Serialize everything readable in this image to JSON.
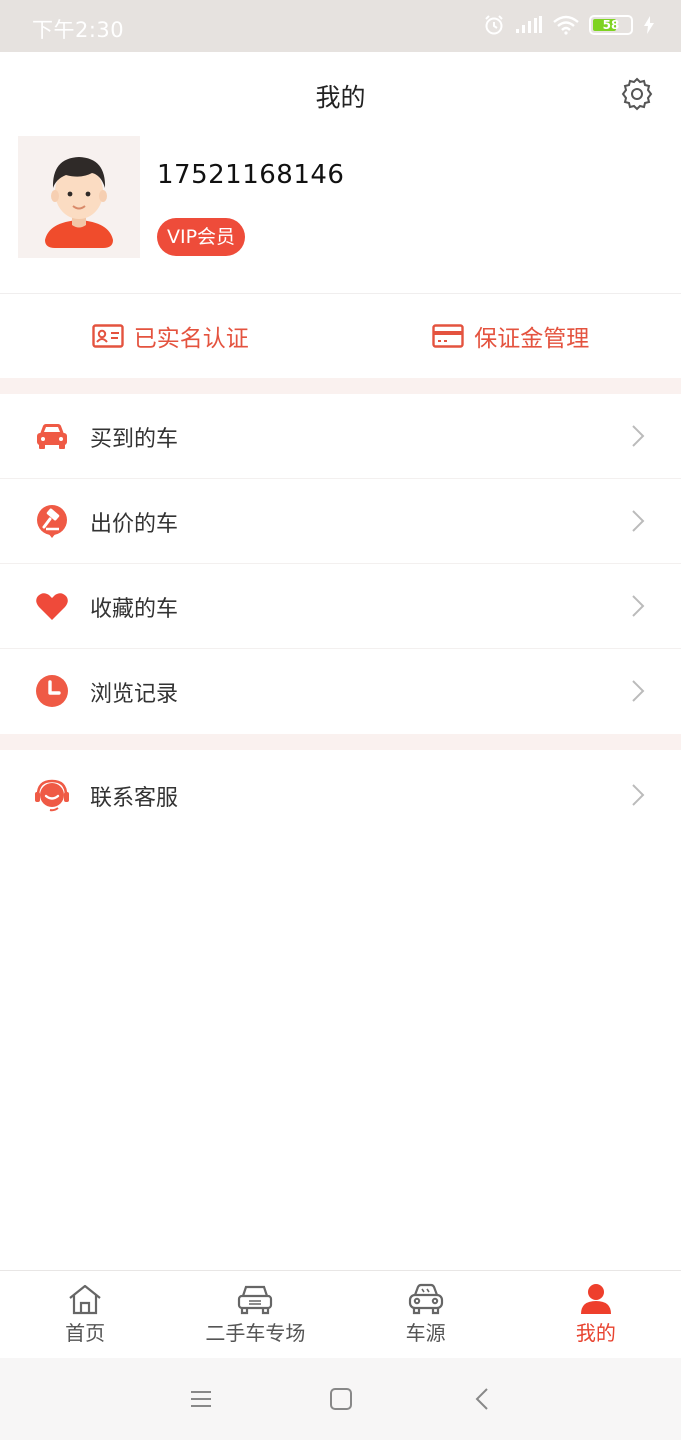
{
  "status_bar": {
    "time": "下午2:30",
    "battery": "58"
  },
  "header": {
    "title": "我的"
  },
  "profile": {
    "phone": "17521168146",
    "vip_label": "VIP会员"
  },
  "quick_actions": [
    {
      "label": "已实名认证",
      "icon": "id-card-icon"
    },
    {
      "label": "保证金管理",
      "icon": "credit-card-icon"
    }
  ],
  "menu": [
    {
      "label": "买到的车",
      "icon": "car-icon"
    },
    {
      "label": "出价的车",
      "icon": "auction-hammer-icon"
    },
    {
      "label": "收藏的车",
      "icon": "heart-icon"
    },
    {
      "label": "浏览记录",
      "icon": "clock-icon"
    },
    {
      "label": "联系客服",
      "icon": "headset-icon"
    }
  ],
  "tabbar": [
    {
      "label": "首页",
      "icon": "home-icon"
    },
    {
      "label": "二手车专场",
      "icon": "car-outline-icon"
    },
    {
      "label": "车源",
      "icon": "car-front-icon"
    },
    {
      "label": "我的",
      "icon": "user-icon",
      "active": true
    }
  ],
  "colors": {
    "accent": "#e8432f",
    "divider": "#faf1ef",
    "status_bar": "#e6e2df"
  }
}
